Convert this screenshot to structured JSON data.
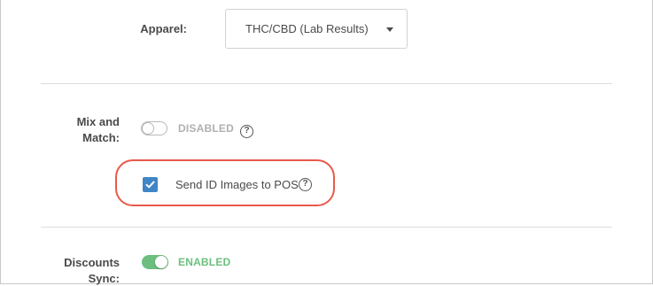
{
  "apparel": {
    "label": "Apparel:",
    "select_value": "THC/CBD (Lab Results)"
  },
  "mix_and_match": {
    "label_line1": "Mix and",
    "label_line2": "Match:",
    "toggle_state": "off",
    "status": "DISABLED",
    "help_glyph": "?"
  },
  "send_id_images": {
    "checked": true,
    "label": "Send ID Images to POS",
    "help_glyph": "?"
  },
  "discounts_sync": {
    "label_line1": "Discounts",
    "label_line2": "Sync:",
    "toggle_state": "on",
    "status": "ENABLED"
  },
  "colors": {
    "enabled": "#6cbf7e",
    "disabled": "#b0b0b0",
    "checkbox": "#3f86c6",
    "highlight": "#e8594b"
  }
}
